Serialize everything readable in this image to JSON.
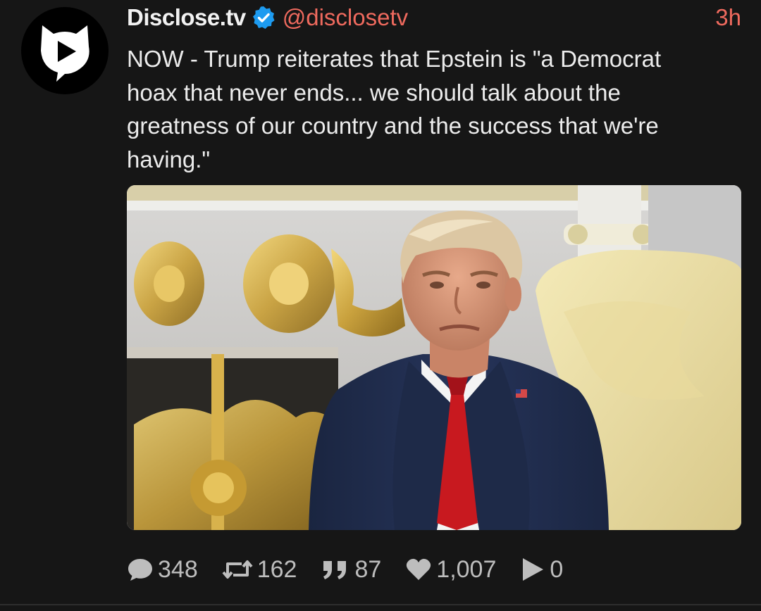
{
  "post": {
    "author": {
      "display_name": "Disclose.tv",
      "handle": "@disclosetv",
      "verified": true,
      "avatar_icon": "disclose-tv-logo-icon"
    },
    "timestamp": "3h",
    "text": "NOW - Trump reiterates that Epstein is \"a Democrat\nhoax that never ends... we should talk about the\ngreatness of our country and the success that we're\nhaving.\"",
    "media": {
      "type": "video-thumbnail"
    },
    "stats": {
      "replies": "348",
      "reposts": "162",
      "quotes": "87",
      "likes": "1,007",
      "views": "0"
    }
  },
  "colors": {
    "background": "#161616",
    "accent": "#ef6a5e",
    "verified": "#1d9bf0",
    "text": "#ececec",
    "muted": "#bdbdbd"
  }
}
